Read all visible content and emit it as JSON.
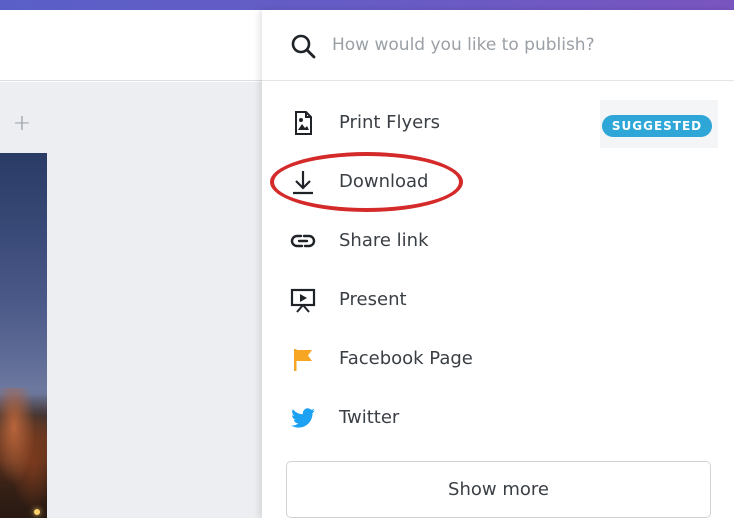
{
  "search": {
    "placeholder": "How would you like to publish?"
  },
  "menu": {
    "items": [
      {
        "label": "Print Flyers",
        "icon": "print-flyers-icon"
      },
      {
        "label": "Download",
        "icon": "download-icon"
      },
      {
        "label": "Share link",
        "icon": "link-icon"
      },
      {
        "label": "Present",
        "icon": "present-icon"
      },
      {
        "label": "Facebook Page",
        "icon": "flag-icon"
      },
      {
        "label": "Twitter",
        "icon": "twitter-icon"
      }
    ],
    "suggested_badge": "SUGGESTED",
    "show_more": "Show more"
  },
  "colors": {
    "accent_bar": "#5a5fc8",
    "badge": "#2ea7d8",
    "highlight": "#d42a2a",
    "facebook_flag": "#f6a623",
    "twitter": "#1da1f2"
  }
}
